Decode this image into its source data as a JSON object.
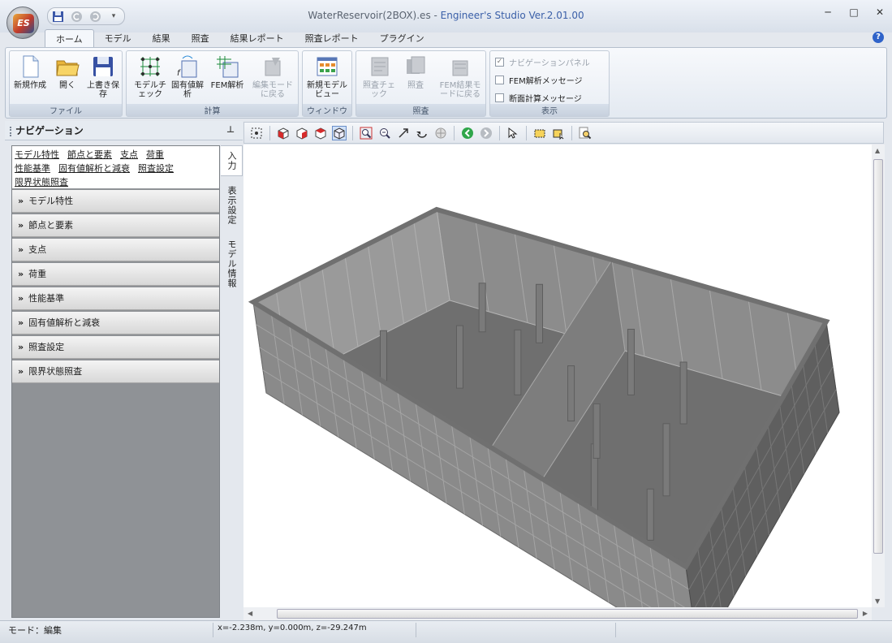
{
  "window": {
    "title_file": "WaterReservoir(2BOX).es - ",
    "title_app": "Engineer's Studio Ver.2.01.00",
    "app_logo": "ES",
    "controls": [
      "─",
      "□",
      "✕"
    ]
  },
  "tabs": [
    "ホーム",
    "モデル",
    "結果",
    "照査",
    "結果レポート",
    "照査レポート",
    "プラグイン"
  ],
  "ribbon": {
    "file": {
      "label": "ファイル",
      "new": "新規作成",
      "open": "開く",
      "save": "上書き保存"
    },
    "calc": {
      "label": "計算",
      "model_check": "モデルチェック",
      "eigen": "固有値解析",
      "fem": "FEM解析",
      "edit_mode": "編集モードに戻る"
    },
    "window": {
      "label": "ウィンドウ",
      "new_view": "新規モデルビュー"
    },
    "verify": {
      "label": "照査",
      "check": "照査チェック",
      "verify": "照査",
      "back_fem": "FEM結果モードに戻る"
    },
    "display": {
      "label": "表示",
      "nav_panel": "ナビゲーションパネル",
      "fem_msg": "FEM解析メッセージ",
      "section_msg": "断面計算メッセージ"
    }
  },
  "nav": {
    "title": "ナビゲーション",
    "links": [
      "モデル特性",
      "節点と要素",
      "支点",
      "荷重",
      "性能基準",
      "固有値解析と減衰",
      "照査設定",
      "限界状態照査"
    ],
    "sections": [
      "モデル特性",
      "節点と要素",
      "支点",
      "荷重",
      "性能基準",
      "固有値解析と減衰",
      "照査設定",
      "限界状態照査"
    ],
    "side_tabs": [
      "入力",
      "表示設定",
      "モデル情報"
    ]
  },
  "status": {
    "mode": "モード：編集",
    "coords": "x=-2.238m, y=0.000m, z=-29.247m"
  }
}
